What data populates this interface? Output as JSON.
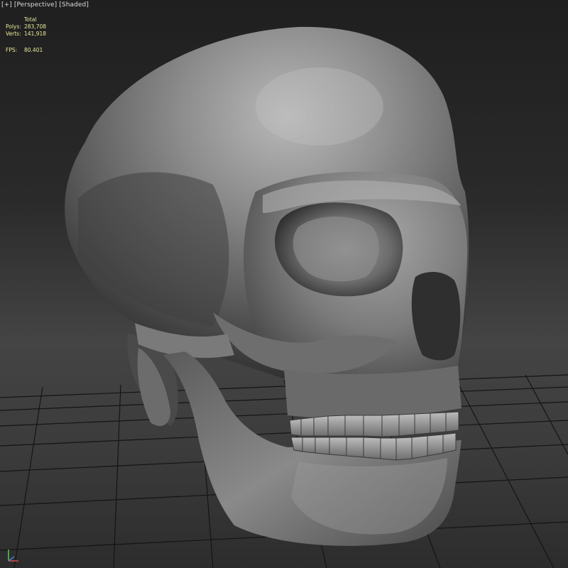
{
  "viewport": {
    "menu_label": "[+]",
    "view_label": "[Perspective]",
    "shading_label": "[Shaded]"
  },
  "stats": {
    "header": "Total",
    "polys_label": "Polys:",
    "polys_value": "283,708",
    "verts_label": "Verts:",
    "verts_value": "141,918",
    "fps_label": "FPS:",
    "fps_value": "80.401"
  },
  "colors": {
    "grid_line": "#151515",
    "stats_text": "#e8e89a",
    "label_text": "#dcdcdc",
    "model": "#8a8a8a"
  },
  "icons": {
    "axis_gizmo": "xyz-axis-icon"
  }
}
